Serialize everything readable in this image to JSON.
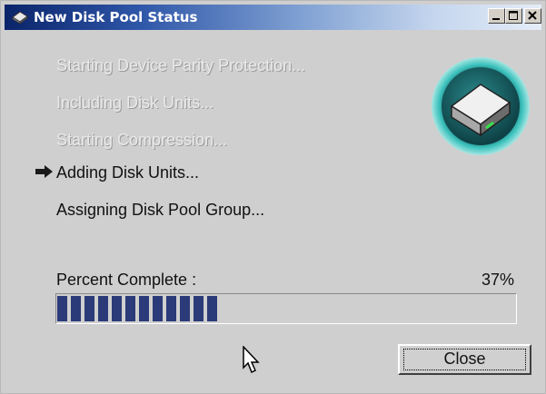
{
  "window": {
    "title": "New Disk Pool Status",
    "title_icon": "disk-pool-icon",
    "controls": [
      "minimize-icon",
      "maximize-icon",
      "close-icon"
    ]
  },
  "steps": [
    {
      "label": "Starting Device Parity Protection...",
      "state": "completed"
    },
    {
      "label": "Including Disk Units...",
      "state": "completed"
    },
    {
      "label": "Starting Compression...",
      "state": "completed"
    },
    {
      "label": "Adding Disk Units...",
      "state": "in-progress"
    },
    {
      "label": "Assigning Disk Pool Group...",
      "state": "pending"
    }
  ],
  "current_step_icon": "right-arrow-icon",
  "status_icon": "disk-unit-icon",
  "progress": {
    "label": "Percent Complete :",
    "value_text": "37%",
    "percent": 37
  },
  "buttons": {
    "close_label": "Close"
  },
  "colors": {
    "progress_fill": "#2b3a78",
    "titlebar": "#0a246a",
    "disk_ring": "#2aa7a5"
  }
}
